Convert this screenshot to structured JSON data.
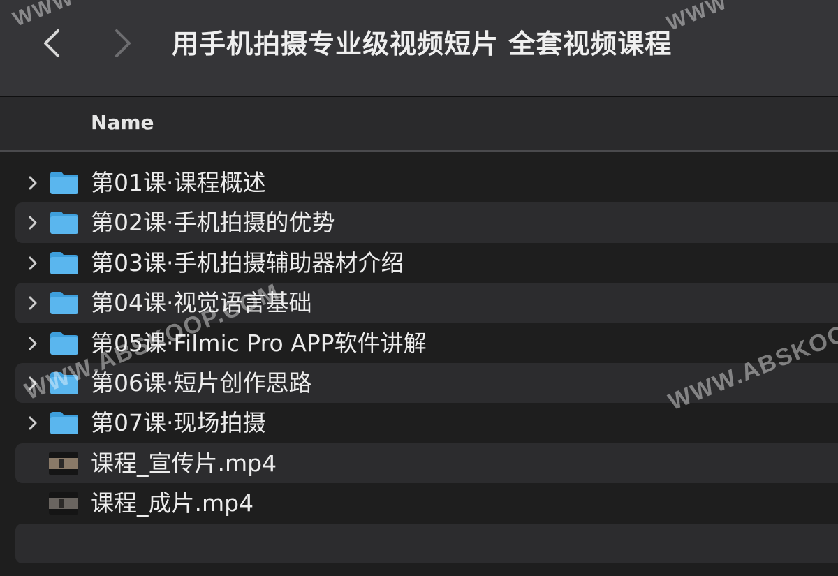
{
  "window": {
    "title": "用手机拍摄专业级视频短片 全套视频课程"
  },
  "columns": {
    "name": "Name"
  },
  "files": [
    {
      "label": "第01课·课程概述",
      "type": "folder"
    },
    {
      "label": "第02课·手机拍摄的优势",
      "type": "folder"
    },
    {
      "label": "第03课·手机拍摄辅助器材介绍",
      "type": "folder"
    },
    {
      "label": "第04课·视觉语言基础",
      "type": "folder"
    },
    {
      "label": "第05课·Filmic Pro APP软件讲解",
      "type": "folder"
    },
    {
      "label": "第06课·短片创作思路",
      "type": "folder"
    },
    {
      "label": "第07课·现场拍摄",
      "type": "folder"
    },
    {
      "label": "课程_宣传片.mp4",
      "type": "video"
    },
    {
      "label": "课程_成片.mp4",
      "type": "video"
    }
  ],
  "watermarks": {
    "left": "WWW.ABSKOOP.COM",
    "right": "WWW.ABSKOOP",
    "top_left": "WWW",
    "top_right": "WWW"
  },
  "colors": {
    "folder": "#5ab6ee",
    "toolbar": "#353538",
    "row_alt": "#2c2c2e",
    "background": "#1e1e1e"
  },
  "icons": {
    "back": "chevron-left-icon",
    "forward": "chevron-right-icon",
    "disclosure": "chevron-right-icon",
    "folder": "folder-icon",
    "video": "video-thumbnail-icon"
  }
}
